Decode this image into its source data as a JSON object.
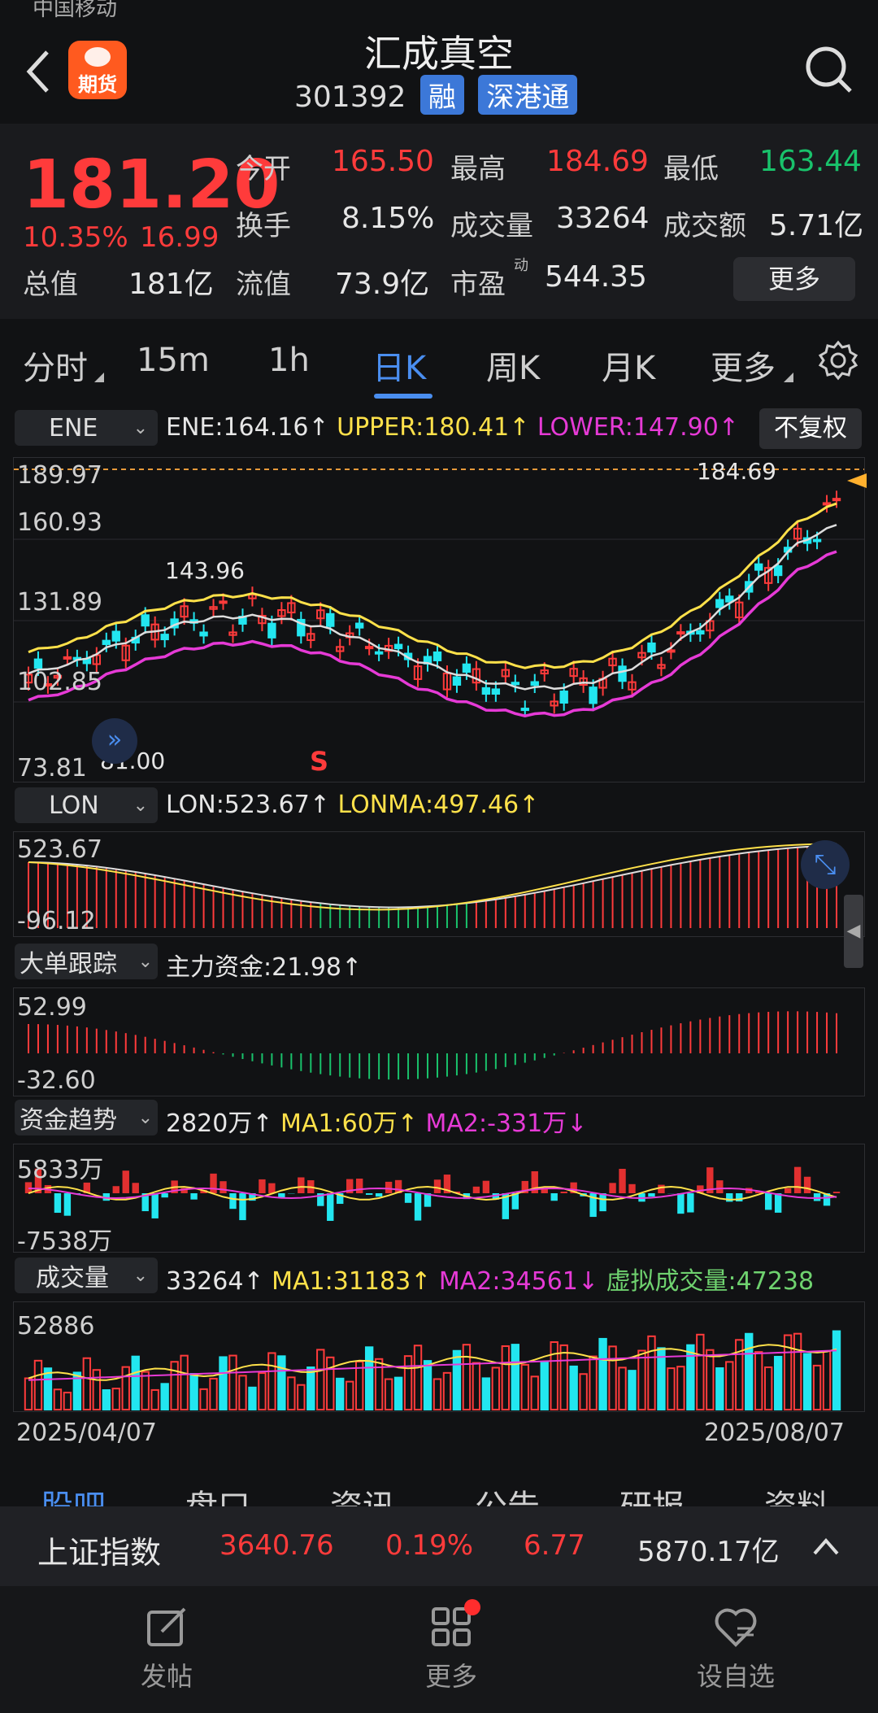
{
  "status_bar": {
    "carrier": "中国移动"
  },
  "header": {
    "title": "汇成真空",
    "code": "301392",
    "badges": [
      "融",
      "深港通"
    ],
    "app_badge": "期货"
  },
  "quote": {
    "price": "181.20",
    "change_pct": "10.35%",
    "change": "16.99",
    "total_value_label": "总值",
    "total_value": "181亿",
    "fields": [
      {
        "label": "今开",
        "value": "165.50",
        "color": "#ff3b3b"
      },
      {
        "label": "最高",
        "value": "184.69",
        "color": "#ff3b3b"
      },
      {
        "label": "最低",
        "value": "163.44",
        "color": "#19c26b"
      },
      {
        "label": "换手",
        "value": "8.15%",
        "color": "#e6e6e6"
      },
      {
        "label": "成交量",
        "value": "33264",
        "color": "#e6e6e6"
      },
      {
        "label": "成交额",
        "value": "5.71亿",
        "color": "#e6e6e6"
      },
      {
        "label": "流值",
        "value": "73.9亿",
        "color": "#e6e6e6"
      },
      {
        "label": "市盈",
        "value": "544.35",
        "color": "#e6e6e6"
      }
    ],
    "pe_super": "动",
    "more_button": "更多"
  },
  "tabs": [
    "分时",
    "15m",
    "1h",
    "日K",
    "周K",
    "月K",
    "更多"
  ],
  "active_tab": "日K",
  "main_chart": {
    "indicator": "ENE",
    "ene": "ENE:164.16↑",
    "upper": "UPPER:180.41↑",
    "lower": "LOWER:147.90↑",
    "adjust_button": "不复权",
    "y_labels": [
      "189.97",
      "160.93",
      "131.89",
      "102.85",
      "73.81"
    ],
    "high_label": "184.69",
    "peak_label": "143.96",
    "low_label": "81.00",
    "signal": "S"
  },
  "lon": {
    "indicator": "LON",
    "lon": "LON:523.67↑",
    "lonma": "LONMA:497.46↑",
    "y_top": "523.67",
    "y_bottom": "-96.12"
  },
  "big_order": {
    "indicator": "大单跟踪",
    "main_fund": "主力资金:21.98↑",
    "y_top": "52.99",
    "y_bottom": "-32.60"
  },
  "fund_trend": {
    "indicator": "资金趋势",
    "value": "2820万↑",
    "ma1": "MA1:60万↑",
    "ma2": "MA2:-331万↓",
    "y_top": "5833万",
    "y_bottom": "-7538万"
  },
  "volume": {
    "indicator": "成交量",
    "value": "33264↑",
    "ma1": "MA1:31183↑",
    "ma2": "MA2:34561↓",
    "virtual": "虚拟成交量:47238",
    "y_top": "52886",
    "date_start": "2025/04/07",
    "date_end": "2025/08/07"
  },
  "bottom_tabs_partial": [
    "股吧",
    "盘口",
    "资讯",
    "公告",
    "研报",
    "资料"
  ],
  "index_bar": {
    "name": "上证指数",
    "price": "3640.76",
    "pct": "0.19%",
    "change": "6.77",
    "amount": "5870.17亿"
  },
  "bottom_nav": [
    {
      "label": "发帖",
      "icon": "edit-icon"
    },
    {
      "label": "更多",
      "icon": "grid-icon"
    },
    {
      "label": "设自选",
      "icon": "heart-list-icon"
    }
  ],
  "colors": {
    "up": "#ff3b3b",
    "down": "#19c26b",
    "accent": "#3c78d8",
    "ma_yellow": "#ffe14a",
    "ma_magenta": "#e63ad6",
    "cyan": "#22e6f0"
  }
}
